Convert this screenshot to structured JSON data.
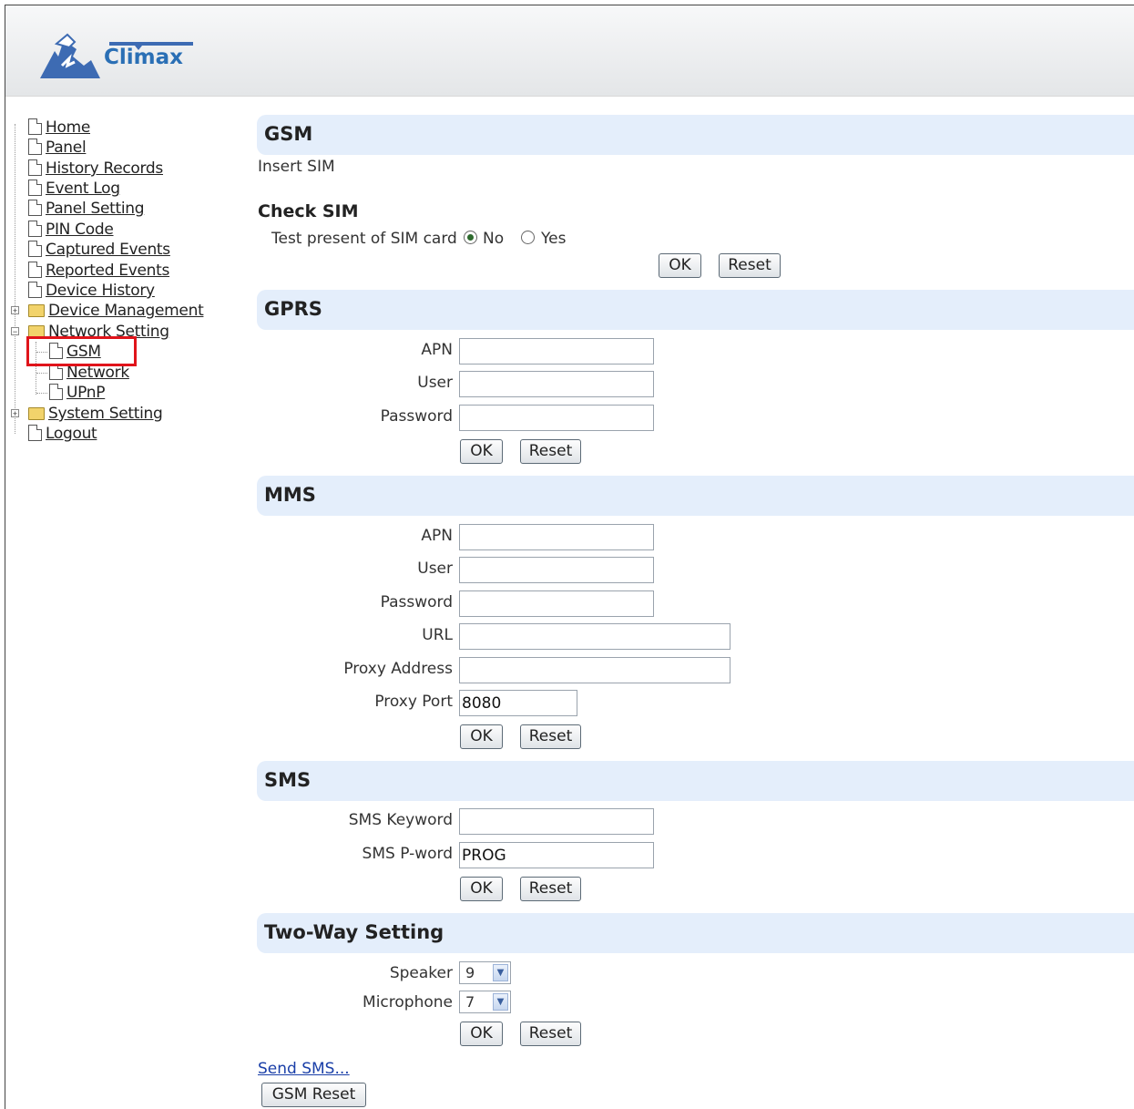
{
  "logo": {
    "text": "Climax"
  },
  "tree": {
    "items": [
      {
        "label": "Home"
      },
      {
        "label": "Panel"
      },
      {
        "label": "History Records"
      },
      {
        "label": "Event Log"
      },
      {
        "label": "Panel Setting"
      },
      {
        "label": "PIN Code"
      },
      {
        "label": "Captured Events"
      },
      {
        "label": "Reported Events"
      },
      {
        "label": "Device History"
      },
      {
        "label": "Device Management"
      },
      {
        "label": "Network Setting"
      },
      {
        "label": "GSM"
      },
      {
        "label": "Network"
      },
      {
        "label": "UPnP"
      },
      {
        "label": "System Setting"
      },
      {
        "label": "Logout"
      }
    ],
    "expand_plus": "+",
    "expand_minus": "−"
  },
  "gsm": {
    "title": "GSM",
    "status": "Insert SIM",
    "check_sim_heading": "Check SIM",
    "test_label": "Test present of SIM card",
    "opt_no": "No",
    "opt_yes": "Yes",
    "selected": "No",
    "ok": "OK",
    "reset": "Reset"
  },
  "gprs": {
    "title": "GPRS",
    "apn_label": "APN",
    "apn_value": "",
    "user_label": "User",
    "user_value": "",
    "password_label": "Password",
    "password_value": "",
    "ok": "OK",
    "reset": "Reset"
  },
  "mms": {
    "title": "MMS",
    "apn_label": "APN",
    "apn_value": "",
    "user_label": "User",
    "user_value": "",
    "password_label": "Password",
    "password_value": "",
    "url_label": "URL",
    "url_value": "",
    "proxy_address_label": "Proxy Address",
    "proxy_address_value": "",
    "proxy_port_label": "Proxy Port",
    "proxy_port_value": "8080",
    "ok": "OK",
    "reset": "Reset"
  },
  "sms": {
    "title": "SMS",
    "keyword_label": "SMS Keyword",
    "keyword_value": "",
    "pword_label": "SMS P-word",
    "pword_value": "PROG",
    "ok": "OK",
    "reset": "Reset"
  },
  "twoway": {
    "title": "Two-Way Setting",
    "speaker_label": "Speaker",
    "speaker_value": "9",
    "microphone_label": "Microphone",
    "microphone_value": "7",
    "ok": "OK",
    "reset": "Reset"
  },
  "footer": {
    "send_sms": "Send SMS...",
    "gsm_reset": "GSM Reset"
  },
  "colors": {
    "accent_bar": "#e4eefb",
    "highlight": "#e0141b",
    "link": "#1a3fa8"
  }
}
